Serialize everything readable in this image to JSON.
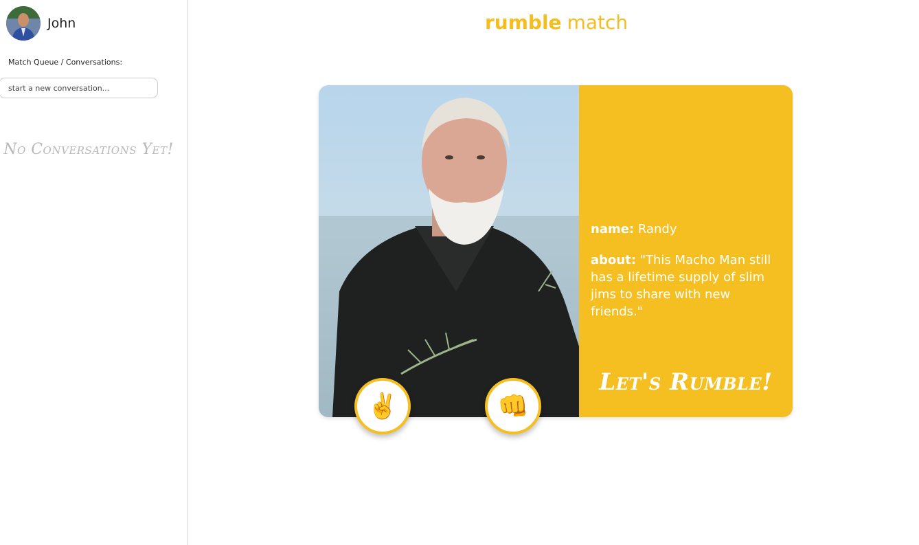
{
  "user": {
    "name": "John",
    "avatar_icon": "user-avatar"
  },
  "sidebar": {
    "queue_label": "Match Queue / Conversations:",
    "new_conversation_placeholder": "start a new conversation...",
    "empty_message": "No Conversations Yet!"
  },
  "logo": {
    "part1": "rumble",
    "part2": "match"
  },
  "profile": {
    "name_label": "name:",
    "name": "Randy",
    "about_label": "about:",
    "about": "\"This Macho Man still has a lifetime supply of slim jims to share with new friends.\"",
    "action_label": "Let's Rumble!"
  },
  "buttons": {
    "pass_glyph": "✌️",
    "pass_icon": "peace-hand-icon",
    "like_glyph": "👊",
    "like_icon": "fist-icon"
  },
  "colors": {
    "accent": "#f6bf21",
    "empty_text": "#b8b8b8"
  }
}
